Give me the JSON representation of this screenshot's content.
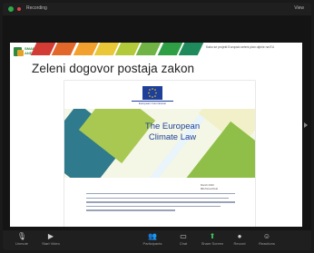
{
  "window": {
    "recording_label": "Recording",
    "view_label": "View"
  },
  "slide": {
    "logo_text": "SMART\nANDWB",
    "top_note": "Kako se projekt Europski zeleni plan utječe na EU",
    "title": "Zeleni dogovor postaja zakon",
    "stripe_colors": [
      "#d33b35",
      "#e2672b",
      "#f2a02e",
      "#e9c736",
      "#b2c93a",
      "#6fb445",
      "#2f9f46",
      "#1f8a5b"
    ]
  },
  "document": {
    "eu_label": "European Commission",
    "cover_title_line1": "The European",
    "cover_title_line2": "Climate Law",
    "date": "March 2020\n#EUGreenDeal",
    "text_line_count_hint": "paragraph"
  },
  "toolbar": {
    "items": [
      {
        "icon": "microphone-icon",
        "glyph": "🎙",
        "label": "Unmute"
      },
      {
        "icon": "video-icon",
        "glyph": "▶",
        "label": "Start Video"
      },
      {
        "icon": "participants-icon",
        "glyph": "👥",
        "label": "Participants"
      },
      {
        "icon": "chat-icon",
        "glyph": "▭",
        "label": "Chat"
      },
      {
        "icon": "share-screen-icon",
        "glyph": "⬆",
        "label": "Share Screen"
      },
      {
        "icon": "record-icon",
        "glyph": "●",
        "label": "Record"
      },
      {
        "icon": "reactions-icon",
        "glyph": "☺",
        "label": "Reactions"
      }
    ]
  }
}
